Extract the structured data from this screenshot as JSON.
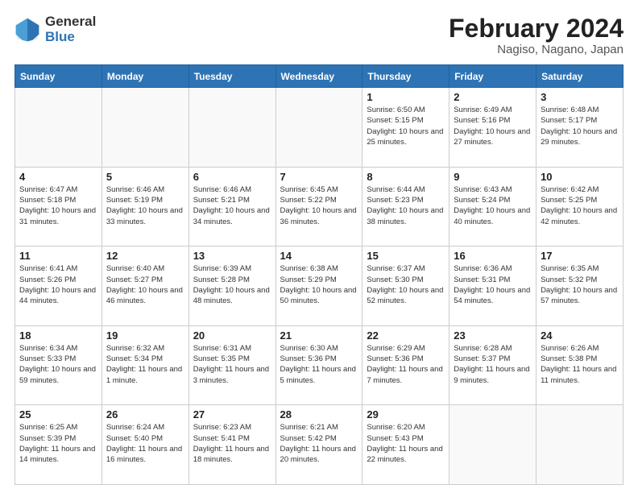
{
  "logo": {
    "general": "General",
    "blue": "Blue"
  },
  "title": {
    "month_year": "February 2024",
    "location": "Nagiso, Nagano, Japan"
  },
  "weekdays": [
    "Sunday",
    "Monday",
    "Tuesday",
    "Wednesday",
    "Thursday",
    "Friday",
    "Saturday"
  ],
  "weeks": [
    [
      {
        "day": "",
        "info": ""
      },
      {
        "day": "",
        "info": ""
      },
      {
        "day": "",
        "info": ""
      },
      {
        "day": "",
        "info": ""
      },
      {
        "day": "1",
        "info": "Sunrise: 6:50 AM\nSunset: 5:15 PM\nDaylight: 10 hours and 25 minutes."
      },
      {
        "day": "2",
        "info": "Sunrise: 6:49 AM\nSunset: 5:16 PM\nDaylight: 10 hours and 27 minutes."
      },
      {
        "day": "3",
        "info": "Sunrise: 6:48 AM\nSunset: 5:17 PM\nDaylight: 10 hours and 29 minutes."
      }
    ],
    [
      {
        "day": "4",
        "info": "Sunrise: 6:47 AM\nSunset: 5:18 PM\nDaylight: 10 hours and 31 minutes."
      },
      {
        "day": "5",
        "info": "Sunrise: 6:46 AM\nSunset: 5:19 PM\nDaylight: 10 hours and 33 minutes."
      },
      {
        "day": "6",
        "info": "Sunrise: 6:46 AM\nSunset: 5:21 PM\nDaylight: 10 hours and 34 minutes."
      },
      {
        "day": "7",
        "info": "Sunrise: 6:45 AM\nSunset: 5:22 PM\nDaylight: 10 hours and 36 minutes."
      },
      {
        "day": "8",
        "info": "Sunrise: 6:44 AM\nSunset: 5:23 PM\nDaylight: 10 hours and 38 minutes."
      },
      {
        "day": "9",
        "info": "Sunrise: 6:43 AM\nSunset: 5:24 PM\nDaylight: 10 hours and 40 minutes."
      },
      {
        "day": "10",
        "info": "Sunrise: 6:42 AM\nSunset: 5:25 PM\nDaylight: 10 hours and 42 minutes."
      }
    ],
    [
      {
        "day": "11",
        "info": "Sunrise: 6:41 AM\nSunset: 5:26 PM\nDaylight: 10 hours and 44 minutes."
      },
      {
        "day": "12",
        "info": "Sunrise: 6:40 AM\nSunset: 5:27 PM\nDaylight: 10 hours and 46 minutes."
      },
      {
        "day": "13",
        "info": "Sunrise: 6:39 AM\nSunset: 5:28 PM\nDaylight: 10 hours and 48 minutes."
      },
      {
        "day": "14",
        "info": "Sunrise: 6:38 AM\nSunset: 5:29 PM\nDaylight: 10 hours and 50 minutes."
      },
      {
        "day": "15",
        "info": "Sunrise: 6:37 AM\nSunset: 5:30 PM\nDaylight: 10 hours and 52 minutes."
      },
      {
        "day": "16",
        "info": "Sunrise: 6:36 AM\nSunset: 5:31 PM\nDaylight: 10 hours and 54 minutes."
      },
      {
        "day": "17",
        "info": "Sunrise: 6:35 AM\nSunset: 5:32 PM\nDaylight: 10 hours and 57 minutes."
      }
    ],
    [
      {
        "day": "18",
        "info": "Sunrise: 6:34 AM\nSunset: 5:33 PM\nDaylight: 10 hours and 59 minutes."
      },
      {
        "day": "19",
        "info": "Sunrise: 6:32 AM\nSunset: 5:34 PM\nDaylight: 11 hours and 1 minute."
      },
      {
        "day": "20",
        "info": "Sunrise: 6:31 AM\nSunset: 5:35 PM\nDaylight: 11 hours and 3 minutes."
      },
      {
        "day": "21",
        "info": "Sunrise: 6:30 AM\nSunset: 5:36 PM\nDaylight: 11 hours and 5 minutes."
      },
      {
        "day": "22",
        "info": "Sunrise: 6:29 AM\nSunset: 5:36 PM\nDaylight: 11 hours and 7 minutes."
      },
      {
        "day": "23",
        "info": "Sunrise: 6:28 AM\nSunset: 5:37 PM\nDaylight: 11 hours and 9 minutes."
      },
      {
        "day": "24",
        "info": "Sunrise: 6:26 AM\nSunset: 5:38 PM\nDaylight: 11 hours and 11 minutes."
      }
    ],
    [
      {
        "day": "25",
        "info": "Sunrise: 6:25 AM\nSunset: 5:39 PM\nDaylight: 11 hours and 14 minutes."
      },
      {
        "day": "26",
        "info": "Sunrise: 6:24 AM\nSunset: 5:40 PM\nDaylight: 11 hours and 16 minutes."
      },
      {
        "day": "27",
        "info": "Sunrise: 6:23 AM\nSunset: 5:41 PM\nDaylight: 11 hours and 18 minutes."
      },
      {
        "day": "28",
        "info": "Sunrise: 6:21 AM\nSunset: 5:42 PM\nDaylight: 11 hours and 20 minutes."
      },
      {
        "day": "29",
        "info": "Sunrise: 6:20 AM\nSunset: 5:43 PM\nDaylight: 11 hours and 22 minutes."
      },
      {
        "day": "",
        "info": ""
      },
      {
        "day": "",
        "info": ""
      }
    ]
  ]
}
